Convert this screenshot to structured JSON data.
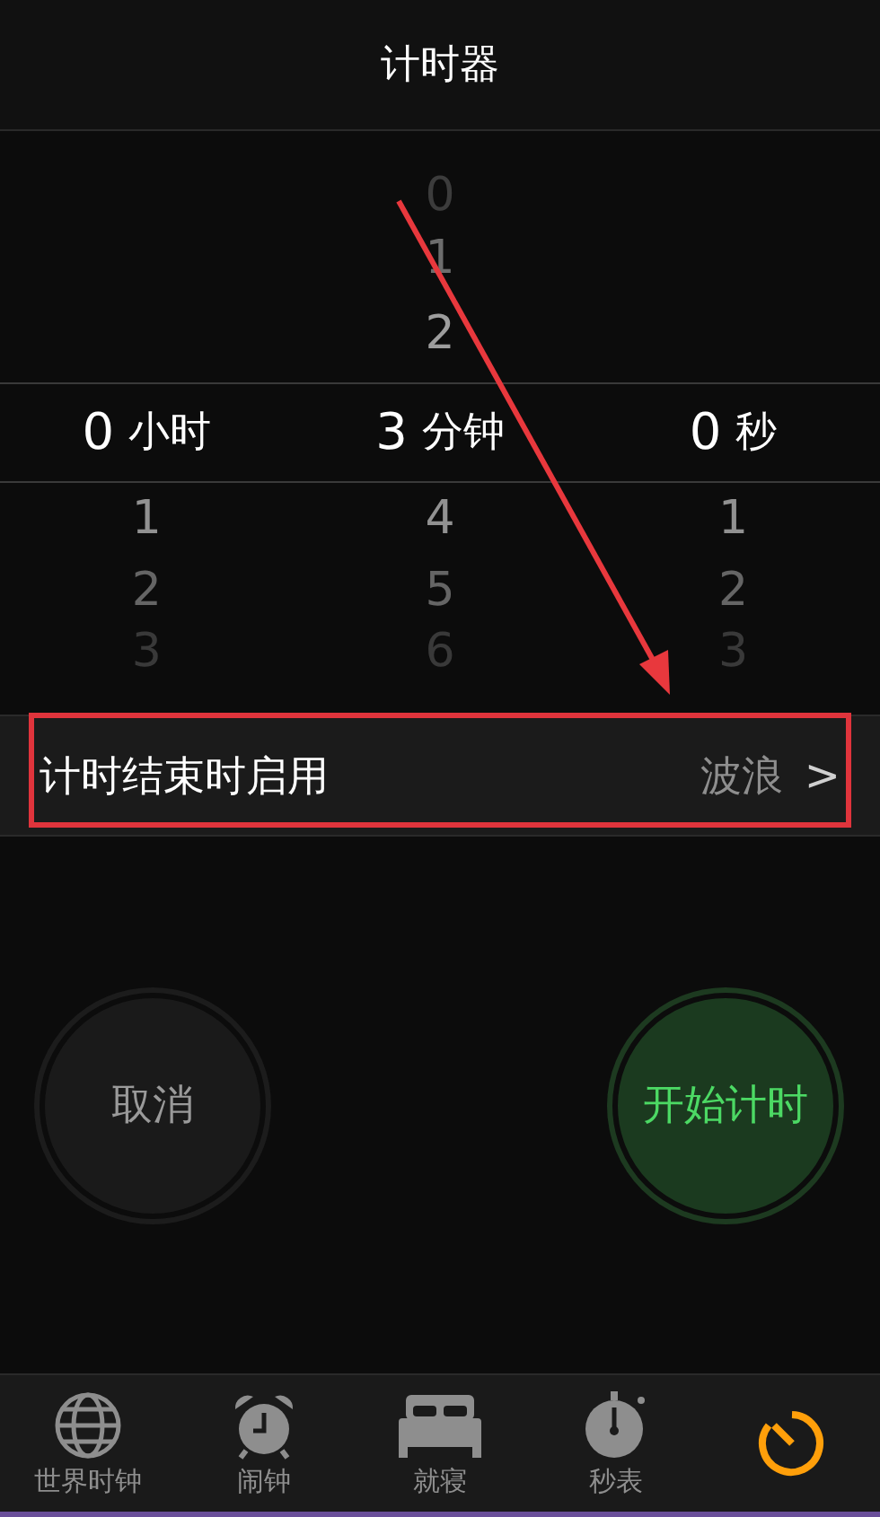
{
  "header": {
    "title": "计时器"
  },
  "picker": {
    "columns": [
      {
        "selected": "0",
        "unit": "小时",
        "below": [
          "1",
          "2",
          "3"
        ]
      },
      {
        "above": [
          "0",
          "1",
          "2"
        ],
        "selected": "3",
        "unit": "分钟",
        "below": [
          "4",
          "5",
          "6"
        ]
      },
      {
        "selected": "0",
        "unit": "秒",
        "below": [
          "1",
          "2",
          "3"
        ]
      }
    ]
  },
  "sound_row": {
    "label": "计时结束时启用",
    "value": "波浪",
    "chevron": ">"
  },
  "buttons": [
    {
      "kind": "cancel",
      "label": "取消"
    },
    {
      "kind": "start",
      "label": "开始计时"
    }
  ],
  "tab_bar": [
    {
      "kind": "globe",
      "label": "世界时钟",
      "selected": false
    },
    {
      "kind": "alarm",
      "label": "闹钟",
      "selected": false
    },
    {
      "kind": "bed",
      "label": "就寝",
      "selected": false
    },
    {
      "kind": "stopwatch",
      "label": "秒表",
      "selected": false
    },
    {
      "kind": "timer",
      "selected": true
    }
  ],
  "annotations": {
    "highlight_box": true,
    "arrow": true
  }
}
